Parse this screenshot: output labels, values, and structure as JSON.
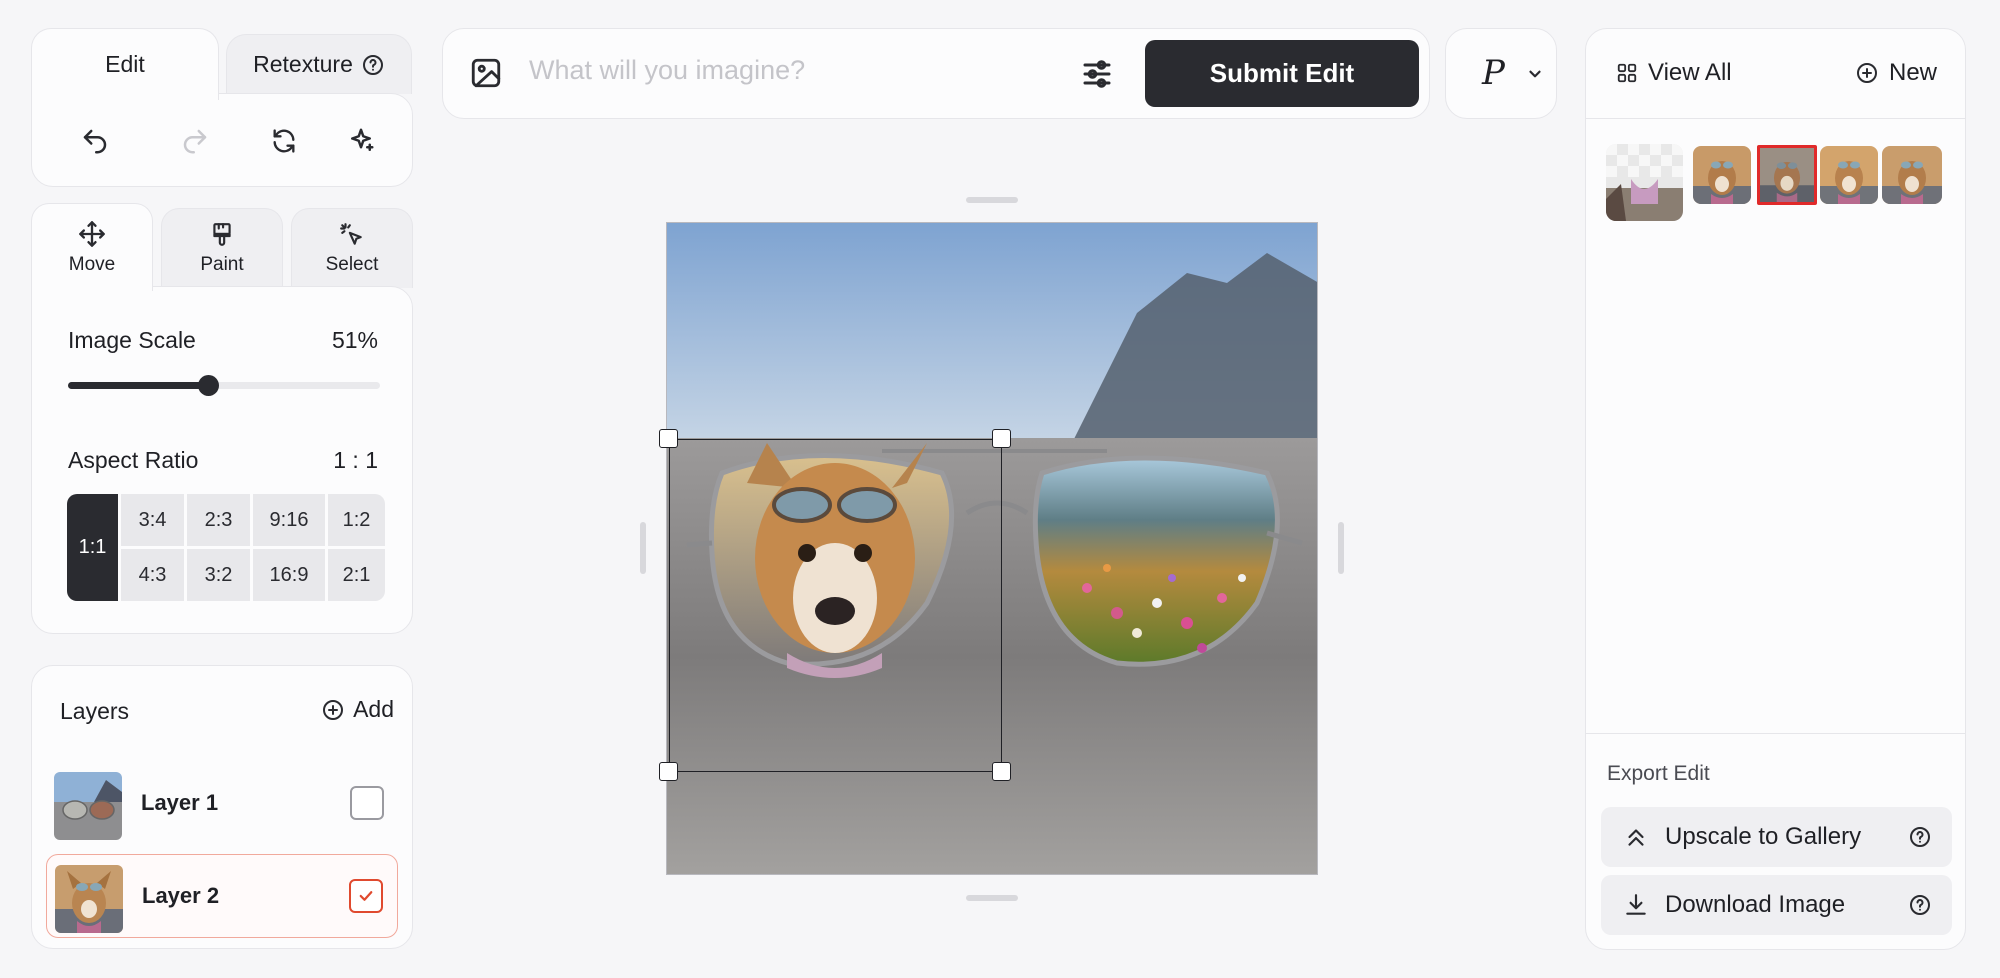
{
  "edit_tabs": {
    "edit": "Edit",
    "retexture": "Retexture"
  },
  "tools": [
    "undo-icon",
    "redo-icon",
    "refresh-icon",
    "sparkle-icon"
  ],
  "modes": {
    "move": "Move",
    "paint": "Paint",
    "select": "Select"
  },
  "image_scale": {
    "label": "Image Scale",
    "value": "51%",
    "fraction": 0.51
  },
  "aspect_ratio": {
    "label": "Aspect Ratio",
    "value": "1 : 1",
    "selected": "1:1",
    "options_top": [
      "3:4",
      "2:3",
      "9:16",
      "1:2"
    ],
    "options_bottom": [
      "4:3",
      "3:2",
      "16:9",
      "2:1"
    ]
  },
  "layers": {
    "title": "Layers",
    "add_label": "Add",
    "items": [
      {
        "name": "Layer 1",
        "checked": false
      },
      {
        "name": "Layer 2",
        "checked": true
      }
    ]
  },
  "prompt": {
    "placeholder": "What will you imagine?",
    "submit_label": "Submit Edit"
  },
  "model": {
    "label": "P"
  },
  "gallery": {
    "view_all": "View All",
    "new_label": "New"
  },
  "export": {
    "label": "Export Edit",
    "upscale": "Upscale to Gallery",
    "download": "Download Image"
  },
  "colors": {
    "accent_dark": "#2a2b30",
    "selected_red": "#e04a2f"
  }
}
